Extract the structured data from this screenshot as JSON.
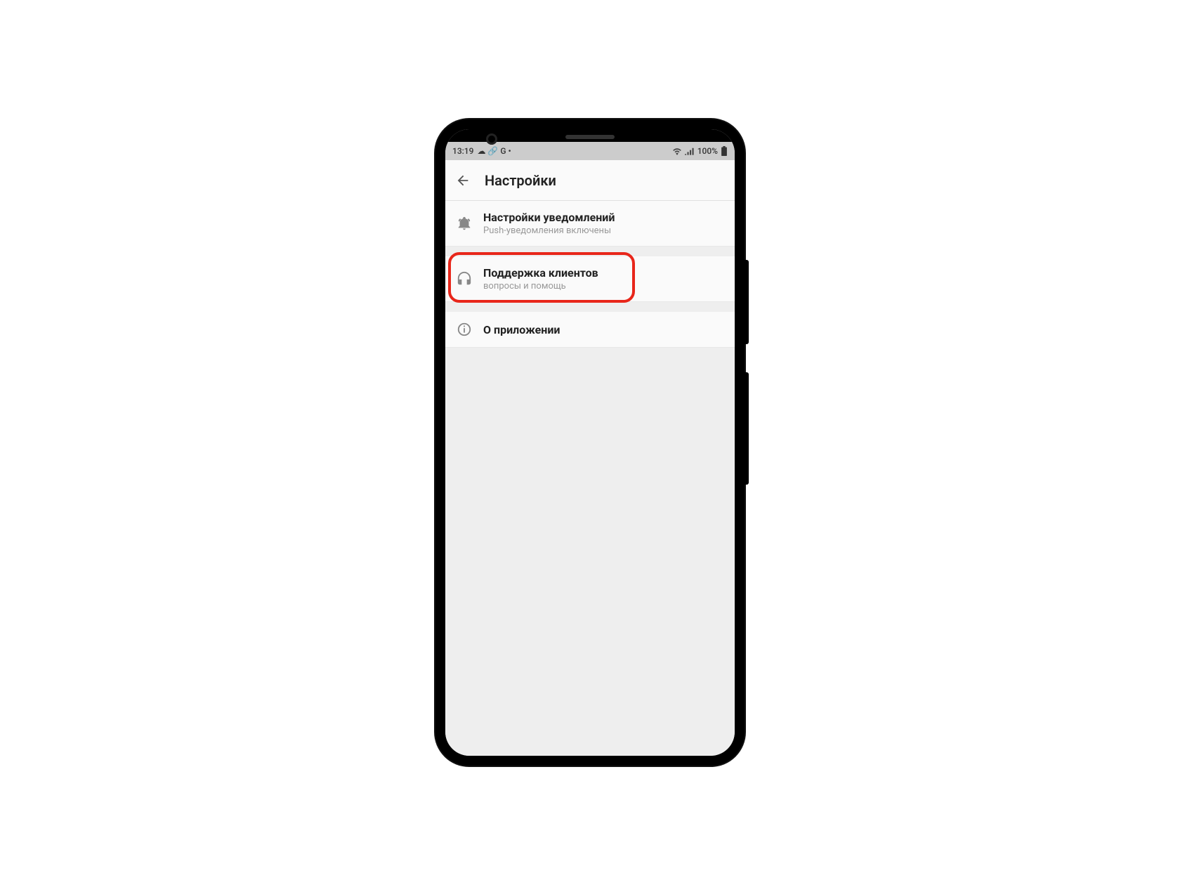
{
  "statusbar": {
    "time": "13:19",
    "indicators_left": "☁ 🔗 G •",
    "battery": "100%"
  },
  "appbar": {
    "title": "Настройки"
  },
  "items": [
    {
      "title": "Настройки уведомлений",
      "subtitle": "Push-уведомления включены"
    },
    {
      "title": "Поддержка клиентов",
      "subtitle": "вопросы и помощь"
    },
    {
      "title": "О приложении",
      "subtitle": ""
    }
  ]
}
